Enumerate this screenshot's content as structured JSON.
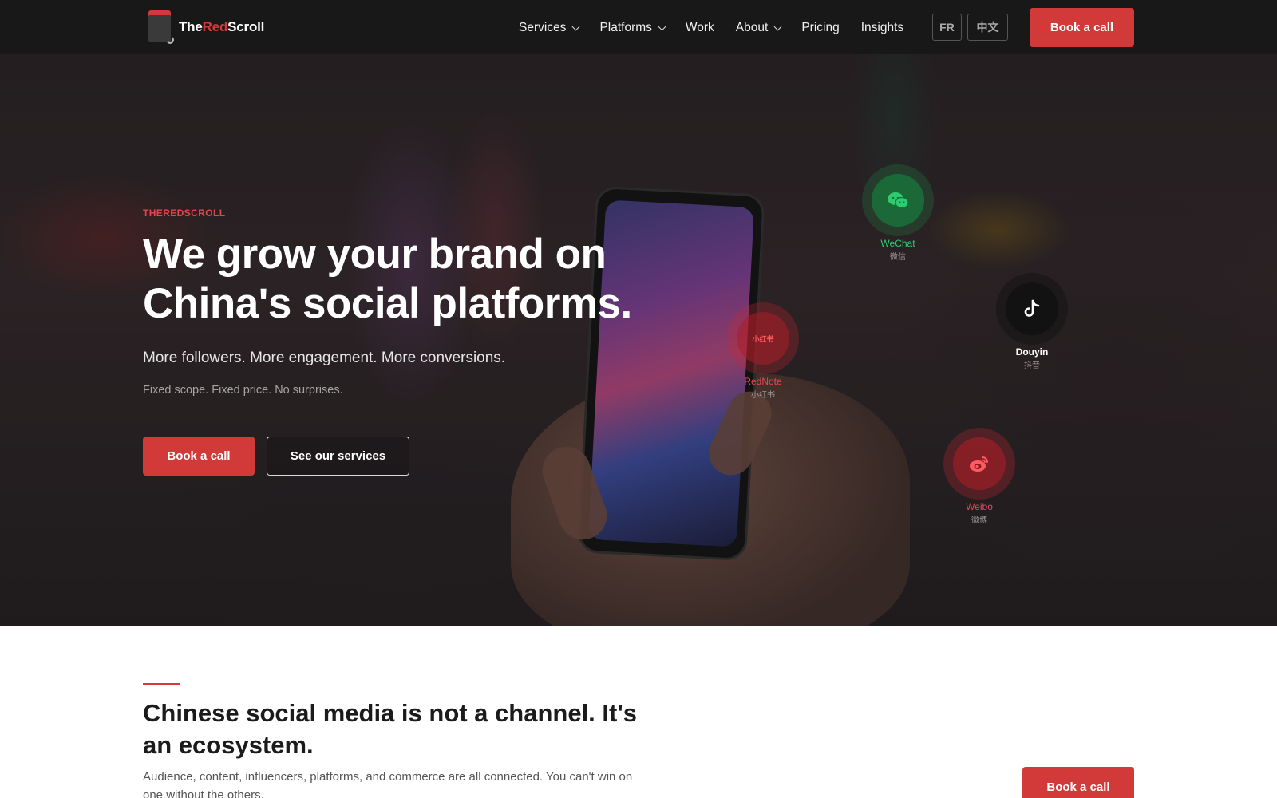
{
  "brand": {
    "the": "The",
    "red": "Red",
    "scroll": "Scroll"
  },
  "nav": {
    "items": [
      {
        "label": "Services",
        "dropdown": true
      },
      {
        "label": "Platforms",
        "dropdown": true
      },
      {
        "label": "Work",
        "dropdown": false
      },
      {
        "label": "About",
        "dropdown": true
      },
      {
        "label": "Pricing",
        "dropdown": false
      },
      {
        "label": "Insights",
        "dropdown": false
      }
    ],
    "lang_fr": "FR",
    "lang_zh": "中文",
    "cta": "Book a call"
  },
  "hero": {
    "eyebrow": "THEREDSCROLL",
    "headline": "We grow your brand on China's social platforms.",
    "subheadline": "More followers. More engagement. More conversions.",
    "note": "Fixed scope. Fixed price. No surprises.",
    "cta_primary": "Book a call",
    "cta_secondary": "See our services"
  },
  "platforms": [
    {
      "name": "WeChat",
      "zh": "微信",
      "icon": "wechat-icon",
      "color": "#2ecc71"
    },
    {
      "name": "Douyin",
      "zh": "抖音",
      "icon": "douyin-icon",
      "color": "#ffffff"
    },
    {
      "name": "RedNote",
      "zh": "小红书",
      "icon": "rednote-icon",
      "color": "#e8484c",
      "badge": "小红书"
    },
    {
      "name": "Weibo",
      "zh": "微博",
      "icon": "weibo-icon",
      "color": "#e8484c"
    }
  ],
  "ecosystem": {
    "title": "Chinese social media is not a channel. It's an ecosystem.",
    "body": "Audience, content, influencers, platforms, and commerce are all connected. You can't win on one without the others.",
    "cta": "Book a call"
  },
  "colors": {
    "accent": "#d23a3a",
    "nav_bg": "#181818",
    "wechat": "#2ecc71"
  }
}
